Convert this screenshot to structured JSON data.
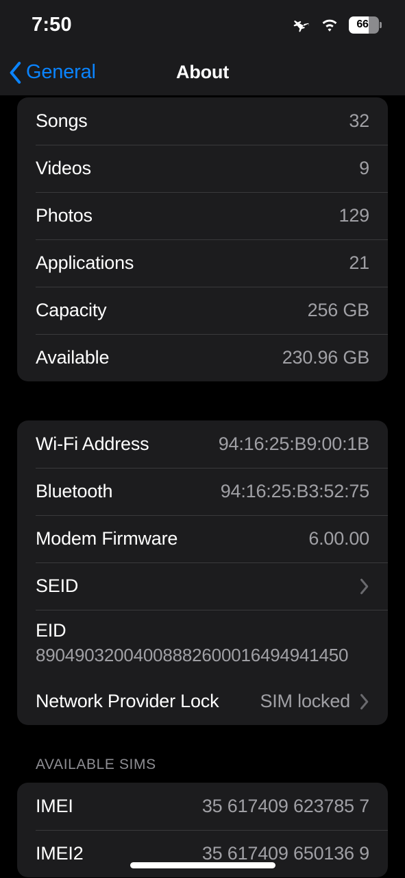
{
  "status_bar": {
    "time": "7:50",
    "battery_percent": "66",
    "battery_level": 66,
    "icons": [
      "airplane-mode-icon",
      "wifi-icon",
      "battery-icon"
    ]
  },
  "nav": {
    "back_label": "General",
    "title": "About",
    "accent_color": "#0A84FF"
  },
  "sections": [
    {
      "header": "",
      "rows": [
        {
          "label": "Songs",
          "value": "32",
          "chevron": false
        },
        {
          "label": "Videos",
          "value": "9",
          "chevron": false
        },
        {
          "label": "Photos",
          "value": "129",
          "chevron": false
        },
        {
          "label": "Applications",
          "value": "21",
          "chevron": false
        },
        {
          "label": "Capacity",
          "value": "256 GB",
          "chevron": false
        },
        {
          "label": "Available",
          "value": "230.96 GB",
          "chevron": false
        }
      ]
    },
    {
      "header": "",
      "rows": [
        {
          "label": "Wi-Fi Address",
          "value": "94:16:25:B9:00:1B",
          "chevron": false
        },
        {
          "label": "Bluetooth",
          "value": "94:16:25:B3:52:75",
          "chevron": false
        },
        {
          "label": "Modem Firmware",
          "value": "6.00.00",
          "chevron": false
        },
        {
          "label": "SEID",
          "value": "",
          "chevron": true
        },
        {
          "label": "EID",
          "value": "89049032004008882600016494941450",
          "chevron": false,
          "stacked": true
        },
        {
          "label": "Network Provider Lock",
          "value": "SIM locked",
          "chevron": true
        }
      ]
    },
    {
      "header": "AVAILABLE SIMS",
      "rows": [
        {
          "label": "IMEI",
          "value": "35 617409 623785 7",
          "chevron": false
        },
        {
          "label": "IMEI2",
          "value": "35 617409 650136 9",
          "chevron": false
        }
      ]
    }
  ],
  "colors": {
    "background": "#000000",
    "card": "#1C1C1E",
    "navbar": "#1B1B1D",
    "separator": "#3A3A3C",
    "label": "#FFFFFF",
    "value": "#A0A0A5",
    "header": "#8E8E93"
  }
}
